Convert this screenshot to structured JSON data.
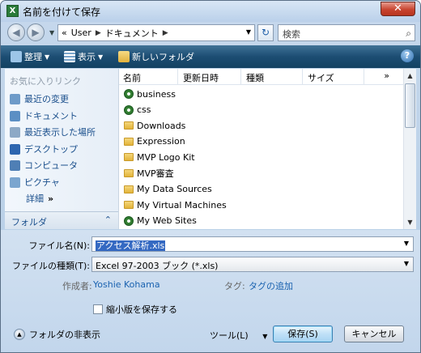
{
  "window": {
    "title": "名前を付けて保存",
    "close_label": "✕"
  },
  "address": {
    "root_marker": "«",
    "crumbs": [
      "User",
      "ドキュメント"
    ],
    "search_placeholder": "検索"
  },
  "toolbar": {
    "organize": "整理",
    "views": "表示",
    "new_folder": "新しいフォルダ",
    "help": "?"
  },
  "sidebar": {
    "favorites_header": "お気に入りリンク",
    "items": [
      {
        "label": "最近の変更"
      },
      {
        "label": "ドキュメント"
      },
      {
        "label": "最近表示した場所"
      },
      {
        "label": "デスクトップ"
      },
      {
        "label": "コンピュータ"
      },
      {
        "label": "ピクチャ"
      },
      {
        "label": "詳細"
      }
    ],
    "folder_label": "フォルダ"
  },
  "columns": [
    "名前",
    "更新日時",
    "種類",
    "サイズ"
  ],
  "files": [
    {
      "name": "business",
      "type": "ie"
    },
    {
      "name": "css",
      "type": "ie"
    },
    {
      "name": "Downloads",
      "type": "folder"
    },
    {
      "name": "Expression",
      "type": "folder"
    },
    {
      "name": "MVP Logo Kit",
      "type": "folder"
    },
    {
      "name": "MVP審査",
      "type": "folder"
    },
    {
      "name": "My Data Sources",
      "type": "folder"
    },
    {
      "name": "My Virtual Machines",
      "type": "folder"
    },
    {
      "name": "My Web Sites",
      "type": "ie"
    }
  ],
  "form": {
    "filename_label": "ファイル名(N):",
    "filename_value": "アクセス解析.xls",
    "filetype_label": "ファイルの種類(T):",
    "filetype_value": "Excel 97-2003 ブック (*.xls)",
    "author_label": "作成者:",
    "author_value": "Yoshie Kohama",
    "tags_label": "タグ:",
    "tags_value": "タグの追加",
    "thumbnail_label": "縮小版を保存する",
    "hide_folders": "フォルダの非表示",
    "tools": "ツール(L)",
    "save": "保存(S)",
    "cancel": "キャンセル"
  }
}
